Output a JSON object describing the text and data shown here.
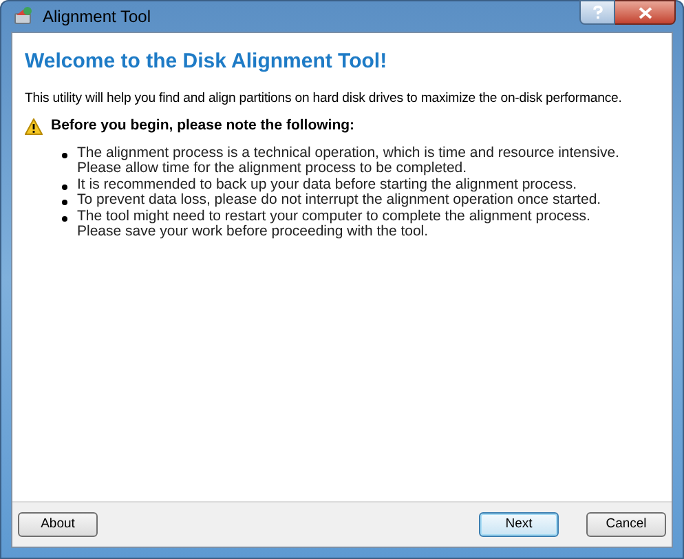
{
  "window": {
    "title": "Alignment Tool"
  },
  "heading": "Welcome to the Disk Alignment Tool!",
  "intro": "This utility will help you find and align partitions on hard disk drives to maximize the on-disk performance.",
  "notice": "Before you begin, please note the following:",
  "bullets": [
    {
      "sentences": [
        "The alignment process is a technical operation, which is time and resource intensive.",
        "Please allow time for the alignment process to be completed."
      ]
    },
    {
      "sentences": [
        "It is recommended to back up your data before starting the alignment process."
      ]
    },
    {
      "sentences": [
        "To prevent data loss, please do not interrupt the alignment operation once started."
      ]
    },
    {
      "sentences": [
        "The tool might need to restart your computer to complete the alignment process.",
        "Please save your work before proceeding with the tool."
      ]
    }
  ],
  "buttons": [
    {
      "label": "About",
      "focused": false
    },
    {
      "label": "Next",
      "focused": true
    },
    {
      "label": "Cancel",
      "focused": false
    }
  ]
}
